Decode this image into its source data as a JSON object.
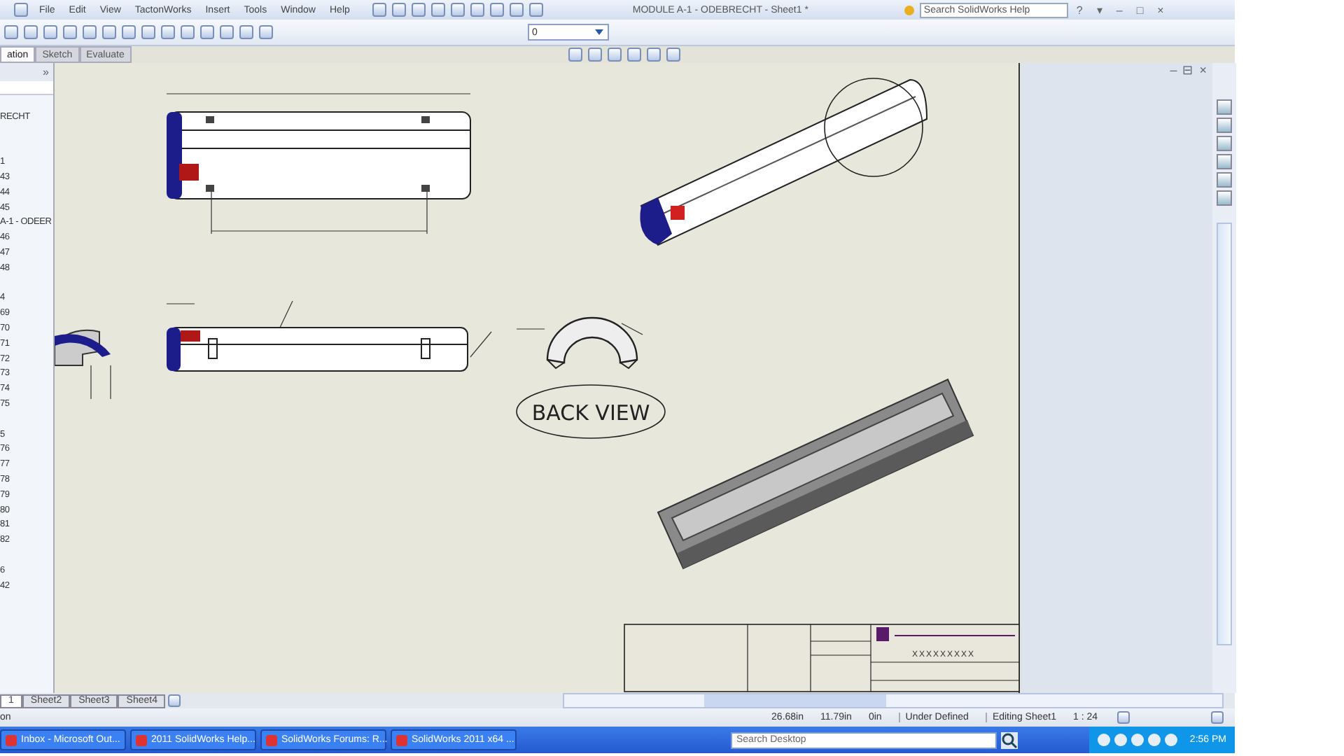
{
  "window": {
    "title": "MODULE A-1 - ODEBRECHT - Sheet1 *",
    "buttons": [
      "?",
      "▾",
      "–",
      "□",
      "×"
    ]
  },
  "menu": [
    "File",
    "Edit",
    "View",
    "TactonWorks",
    "Insert",
    "Tools",
    "Window",
    "Help"
  ],
  "help_search": {
    "placeholder": "Search SolidWorks Help"
  },
  "layer_dropdown": {
    "value": "0"
  },
  "command_tabs": [
    {
      "label": "ation",
      "selected": true
    },
    {
      "label": "Sketch",
      "selected": false
    },
    {
      "label": "Evaluate",
      "selected": false
    }
  ],
  "feature_tree": {
    "expand": "»",
    "groups": [
      [
        "RECHT"
      ],
      [
        "1",
        "43",
        "44",
        "45",
        "A-1 - ODEER",
        "46",
        "47",
        "48"
      ],
      [
        "4",
        "69",
        "70",
        "71",
        "72",
        "73",
        "74",
        "75"
      ],
      [
        "5",
        "76",
        "77",
        "78",
        "79",
        "80",
        "81",
        "82"
      ],
      [
        "6",
        "42"
      ]
    ]
  },
  "drawing": {
    "view_label": "BACK VIEW",
    "title_block_title": "XXXXXXXXX"
  },
  "doc_buttons": [
    "–",
    "⊟",
    "×"
  ],
  "sheet_tabs": [
    {
      "label": "1",
      "selected": true
    },
    {
      "label": "Sheet2",
      "selected": false
    },
    {
      "label": "Sheet3",
      "selected": false
    },
    {
      "label": "Sheet4",
      "selected": false
    }
  ],
  "status_bar": {
    "left": "on",
    "x": "26.68in",
    "y": "11.79in",
    "z": "0in",
    "state": "Under Defined",
    "editing": "Editing Sheet1",
    "scale": "1 : 24"
  },
  "taskbar": {
    "items": [
      "Inbox - Microsoft Out...",
      "2011 SolidWorks Help...",
      "SolidWorks Forums: R...",
      "SolidWorks 2011 x64 ..."
    ],
    "search": {
      "placeholder": "Search Desktop"
    },
    "time": "2:56 PM"
  }
}
